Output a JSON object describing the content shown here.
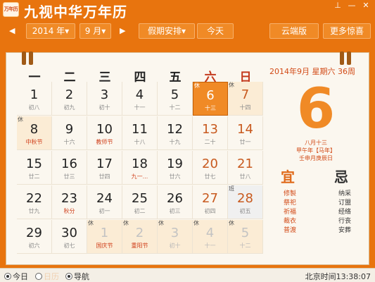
{
  "title": "九视中华万年历",
  "logo": "万年历",
  "window": {
    "pin": "⊥",
    "minimize": "—",
    "close": "✕"
  },
  "toolbar": {
    "prev": "◀",
    "year": "2014 年▾",
    "month": "9 月▾",
    "next": "▶",
    "holiday": "假期安排▾",
    "today": "今天",
    "cloud": "云端版",
    "more": "更多惊喜"
  },
  "weekdays": [
    "一",
    "二",
    "三",
    "四",
    "五",
    "六",
    "日"
  ],
  "days": [
    [
      {
        "d": "1",
        "s": "初八"
      },
      {
        "d": "2",
        "s": "初九"
      },
      {
        "d": "3",
        "s": "初十"
      },
      {
        "d": "4",
        "s": "十一"
      },
      {
        "d": "5",
        "s": "十二"
      },
      {
        "d": "6",
        "s": "十三",
        "t": "休"
      },
      {
        "d": "7",
        "s": "十四",
        "t": "休"
      }
    ],
    [
      {
        "d": "8",
        "s": "中秋节",
        "t": "休"
      },
      {
        "d": "9",
        "s": "十六"
      },
      {
        "d": "10",
        "s": "教师节"
      },
      {
        "d": "11",
        "s": "十八"
      },
      {
        "d": "12",
        "s": "十九"
      },
      {
        "d": "13",
        "s": "二十"
      },
      {
        "d": "14",
        "s": "廿一"
      }
    ],
    [
      {
        "d": "15",
        "s": "廿二"
      },
      {
        "d": "16",
        "s": "廿三"
      },
      {
        "d": "17",
        "s": "廿四"
      },
      {
        "d": "18",
        "s": "九一..."
      },
      {
        "d": "19",
        "s": "廿六"
      },
      {
        "d": "20",
        "s": "廿七"
      },
      {
        "d": "21",
        "s": "廿八"
      }
    ],
    [
      {
        "d": "22",
        "s": "廿九"
      },
      {
        "d": "23",
        "s": "秋分"
      },
      {
        "d": "24",
        "s": "初一"
      },
      {
        "d": "25",
        "s": "初二"
      },
      {
        "d": "26",
        "s": "初三"
      },
      {
        "d": "27",
        "s": "初四"
      },
      {
        "d": "28",
        "s": "初五",
        "t": "班"
      }
    ],
    [
      {
        "d": "29",
        "s": "初六"
      },
      {
        "d": "30",
        "s": "初七"
      },
      {
        "d": "1",
        "s": "国庆节",
        "t": "休"
      },
      {
        "d": "2",
        "s": "重阳节",
        "t": "休"
      },
      {
        "d": "3",
        "s": "初十",
        "t": "休"
      },
      {
        "d": "4",
        "s": "十一",
        "t": "休"
      },
      {
        "d": "5",
        "s": "十二",
        "t": "休"
      }
    ]
  ],
  "detail": {
    "date_line": "2014年9月 星期六 36周",
    "big_day": "6",
    "lunar": "八月十三",
    "ganzhi_year": "甲午年【马年】",
    "ganzhi_day": "壬申月庚辰日",
    "yi_label": "宜",
    "ji_label": "忌",
    "yi": [
      "修製",
      "祭祀",
      "祈福",
      "裁衣",
      "普渡"
    ],
    "ji": [
      "纳采",
      "订盟",
      "经络",
      "行丧",
      "安葬"
    ]
  },
  "status": {
    "today": "今日",
    "calendar": "日历",
    "nav": "导航",
    "clock": "北京时间13:38:07"
  }
}
